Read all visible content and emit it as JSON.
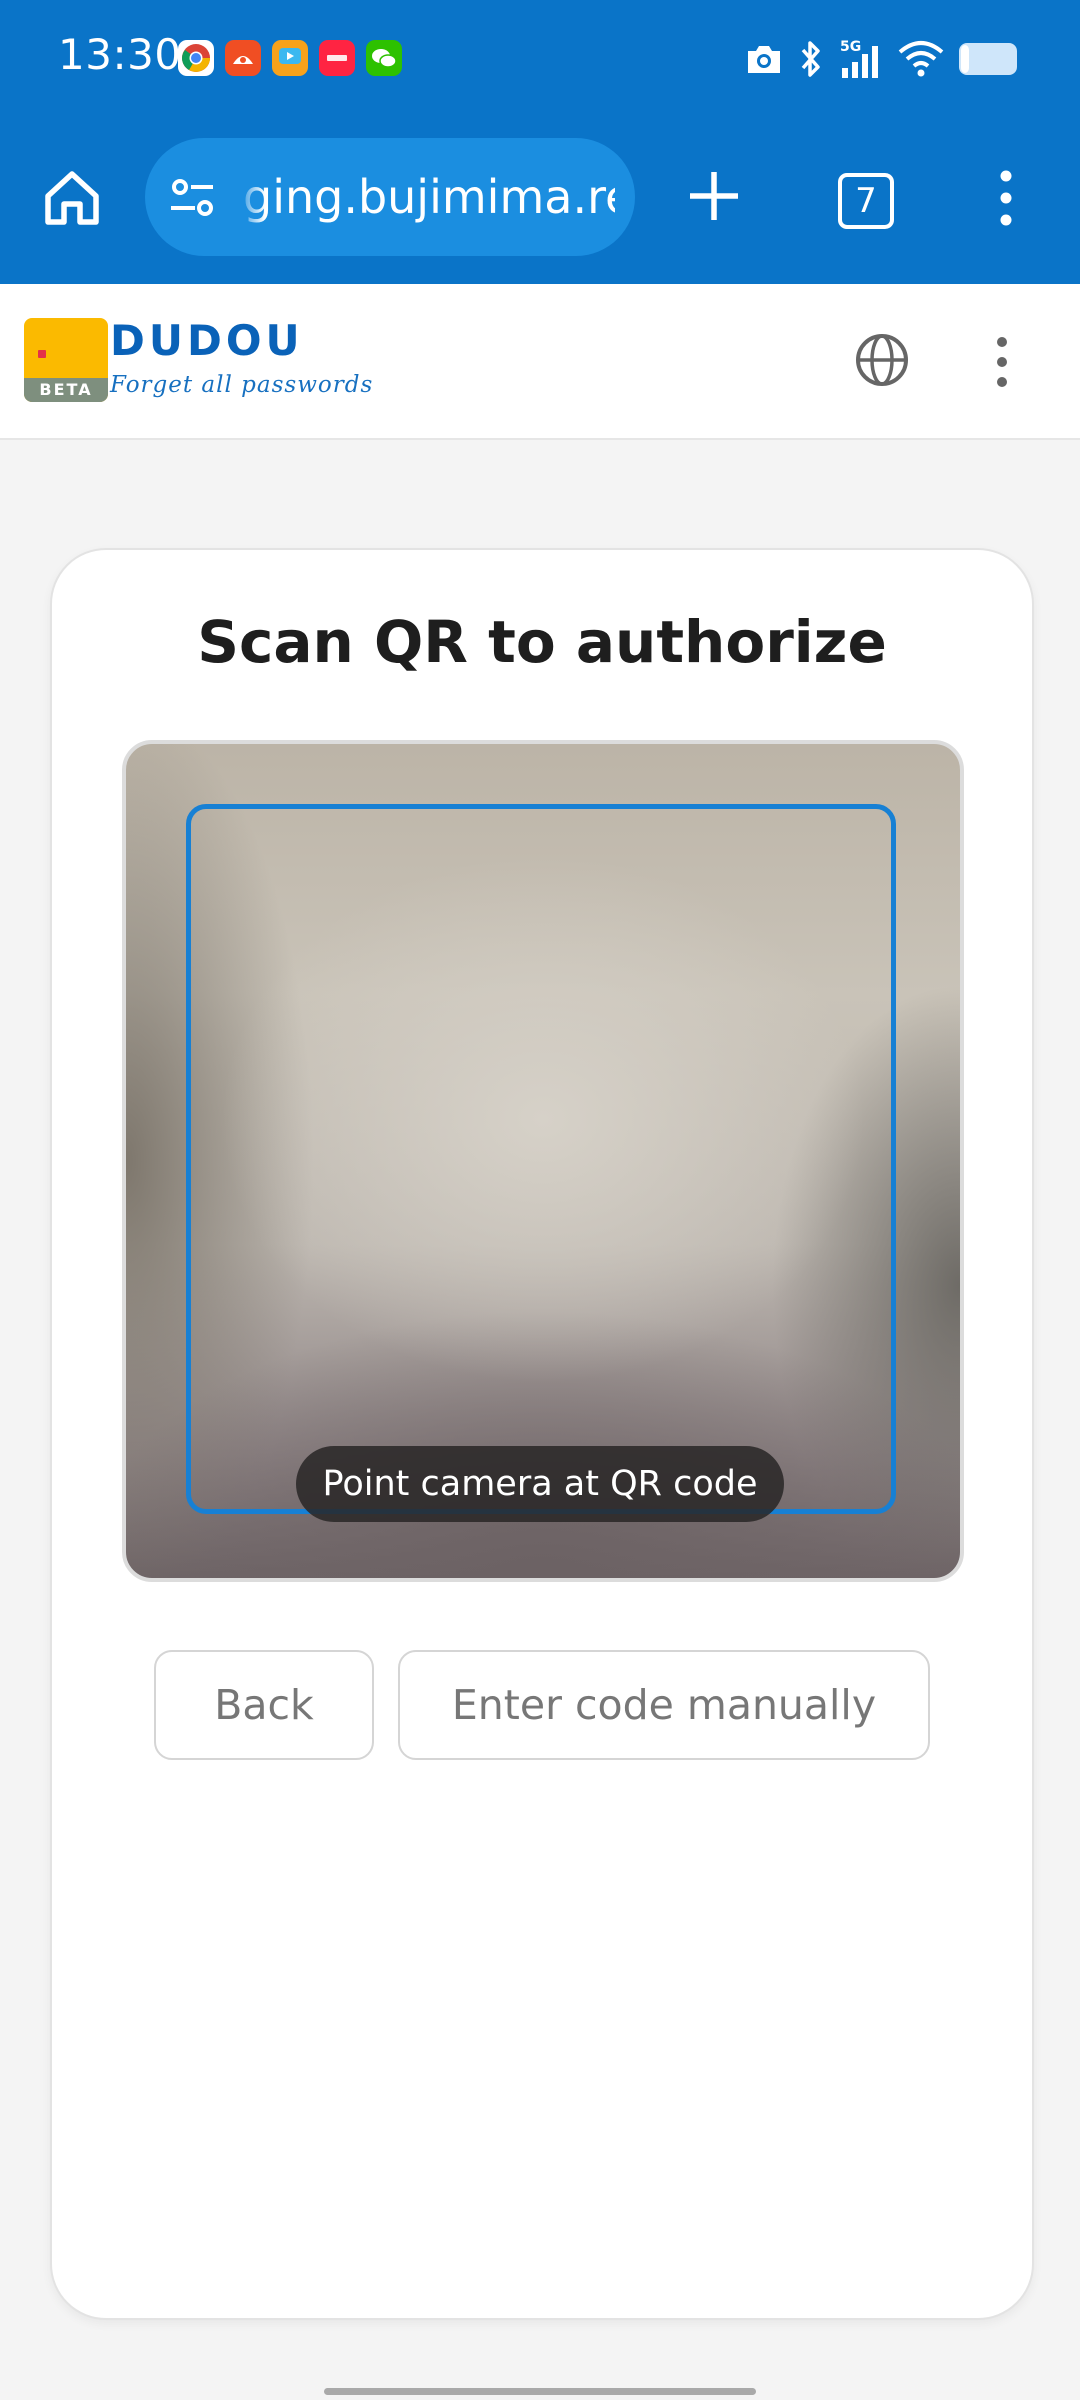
{
  "status_bar": {
    "time": "13:30",
    "app_icons": [
      "chrome-icon",
      "app-red-icon",
      "video-app-icon",
      "xiaohongshu-icon",
      "wechat-icon"
    ],
    "network": "5G",
    "right_icons": [
      "camera-icon",
      "bluetooth-icon",
      "signal-icon",
      "wifi-icon",
      "battery-icon"
    ]
  },
  "browser": {
    "url": "ging.bujimima.ren",
    "tab_count": "7",
    "accent_color": "#0A74C8"
  },
  "site": {
    "brand": "DUDOU",
    "tagline": "Forget all passwords",
    "badge": "BETA"
  },
  "scan": {
    "title": "Scan QR to authorize",
    "hint": "Point camera at QR code",
    "back_label": "Back",
    "manual_label": "Enter code manually"
  }
}
